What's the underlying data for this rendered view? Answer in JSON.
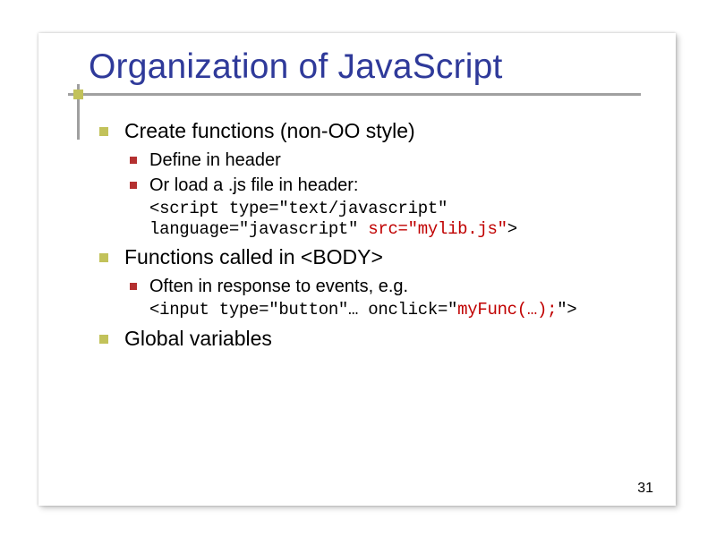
{
  "title": "Organization of JavaScript",
  "b1": "Create functions (non-OO style)",
  "b1a": "Define in header",
  "b1b": "Or load a .js file in header:",
  "code1a": "<script type=\"text/javascript\"",
  "code1b": "language=\"javascript\" ",
  "code1c": "src=\"mylib.js\"",
  "code1d": ">",
  "b2": "Functions called in <BODY>",
  "b2a": "Often in response to events, e.g.",
  "code2a": "<input type=\"button\"… onclick=\"",
  "code2b": "myFunc(…);",
  "code2c": "\">",
  "b3": "Global variables",
  "pageNum": "31"
}
